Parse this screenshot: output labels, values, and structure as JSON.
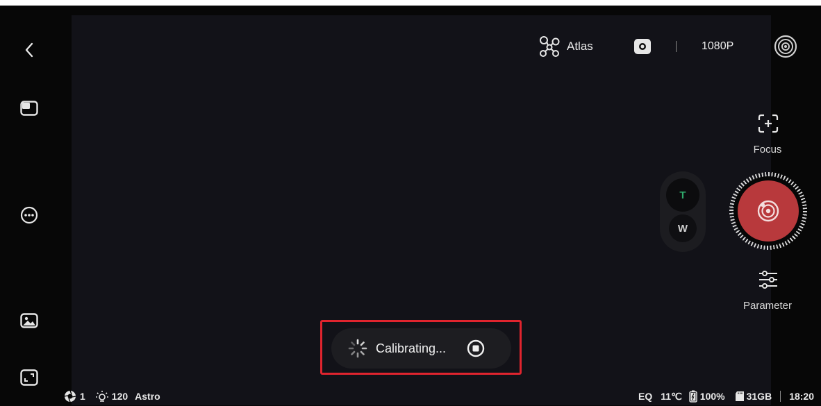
{
  "top_bar": {
    "mode_label": "Atlas",
    "resolution": "1080P"
  },
  "right_panel": {
    "focus_label": "Focus",
    "parameter_label": "Parameter",
    "zoom_tele": "T",
    "zoom_wide": "W"
  },
  "calibration": {
    "label": "Calibrating..."
  },
  "status_bar": {
    "sessions": "1",
    "brightness": "120",
    "scene": "Astro",
    "mount_mode": "EQ",
    "temperature": "11℃",
    "battery": "100%",
    "storage": "31GB",
    "time": "18:20"
  },
  "colors": {
    "shutter": "#b8393c",
    "zoom_tele_text": "#2ea86a",
    "highlight": "#e0242e"
  },
  "icons": {
    "back": "chevron-left-icon",
    "layout": "layout-icon",
    "more": "more-icon",
    "gallery": "gallery-icon",
    "fullscreen": "fullscreen-icon",
    "atlas": "constellation-icon",
    "camera": "camera-icon",
    "target": "target-icon",
    "focus": "focus-icon",
    "parameter": "sliders-icon",
    "spinner": "spinner-icon",
    "stop": "stop-icon"
  }
}
